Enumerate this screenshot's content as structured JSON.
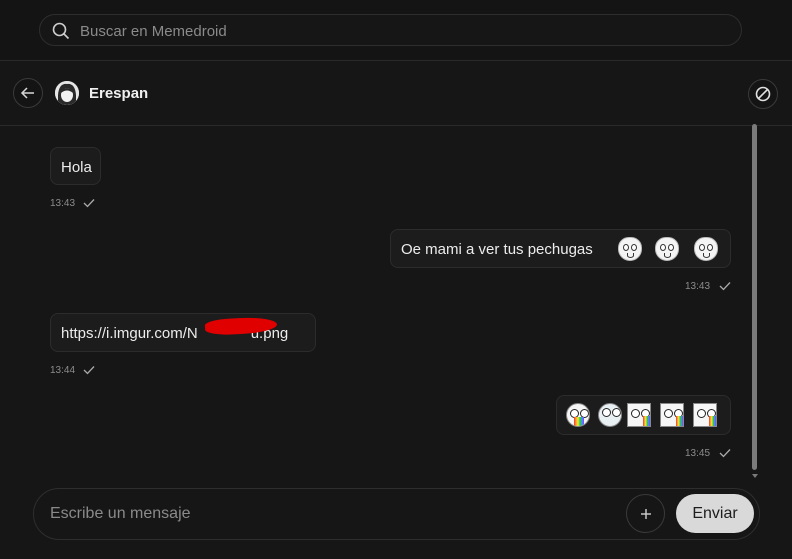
{
  "search": {
    "placeholder": "Buscar en Memedroid"
  },
  "chat": {
    "username": "Erespan",
    "messages": [
      {
        "text": "Hola",
        "time": "13:43",
        "side": "left"
      },
      {
        "text": "Oe mami a ver tus pechugas",
        "emojis": [
          "dubious-face",
          "dubious-face",
          "dubious-face"
        ],
        "time": "13:43",
        "side": "right"
      },
      {
        "text": "https://i.imgur.com/N",
        "text_tail": "u.png",
        "redacted": true,
        "time": "13:44",
        "side": "left"
      },
      {
        "text": "",
        "emojis": [
          "rainbow-puke",
          "rage-face",
          "rainbow-face",
          "rainbow-face",
          "rainbow-face"
        ],
        "time": "13:45",
        "side": "right"
      }
    ]
  },
  "composer": {
    "placeholder": "Escribe un mensaje",
    "send_label": "Enviar"
  },
  "colors": {
    "background": "#121212",
    "panel": "#161616",
    "bubble": "#1c1c1c",
    "send_button": "#d9d9d9",
    "redaction": "#e10000"
  }
}
